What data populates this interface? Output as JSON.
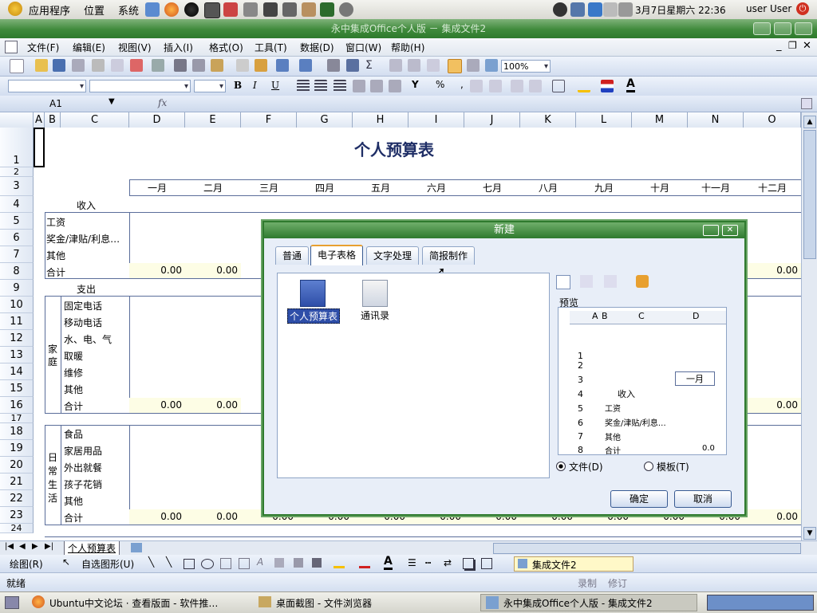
{
  "top_panel": {
    "menus": [
      "应用程序",
      "位置",
      "系统"
    ],
    "clock": "3月7日星期六 22:36",
    "user": "user User"
  },
  "window": {
    "title": "永中集成Office个人版 － 集成文件2"
  },
  "menubar": [
    "文件(F)",
    "编辑(E)",
    "视图(V)",
    "插入(I)",
    "格式(O)",
    "工具(T)",
    "数据(D)",
    "窗口(W)",
    "帮助(H)"
  ],
  "toolbar": {
    "zoom": "100%"
  },
  "formula": {
    "name_box": "A1",
    "fx": "fx"
  },
  "columns": [
    "A",
    "B",
    "C",
    "D",
    "E",
    "F",
    "G",
    "H",
    "I",
    "J",
    "K",
    "L",
    "M",
    "N",
    "O"
  ],
  "rows": [
    "1",
    "2",
    "3",
    "4",
    "5",
    "6",
    "7",
    "8",
    "9",
    "10",
    "11",
    "12",
    "13",
    "14",
    "15",
    "16",
    "17",
    "18",
    "19",
    "20",
    "21",
    "22",
    "23",
    "24"
  ],
  "sheet": {
    "title": "个人预算表",
    "months": [
      "一月",
      "二月",
      "三月",
      "四月",
      "五月",
      "六月",
      "七月",
      "八月",
      "九月",
      "十月",
      "十一月",
      "十二月"
    ],
    "income_label": "收入",
    "income_items": [
      "工资",
      "奖金/津贴/利息…",
      "其他",
      "合计"
    ],
    "expense_label": "支出",
    "family_group": "家庭",
    "family_items": [
      "固定电话",
      "移动电话",
      "水、电、气",
      "取暖",
      "维修",
      "其他",
      "合计"
    ],
    "daily_group": "日常生活",
    "daily_items": [
      "食品",
      "家居用品",
      "外出就餐",
      "孩子花销",
      "其他",
      "合计"
    ],
    "zero": "0.00"
  },
  "dialog": {
    "title": "新建",
    "tabs": [
      "普通",
      "电子表格",
      "文字处理",
      "简报制作"
    ],
    "templates": [
      "个人预算表",
      "通讯录"
    ],
    "preview_label": "预览",
    "preview": {
      "cols": [
        "A",
        "B",
        "C",
        "D"
      ],
      "rows": [
        "1",
        "2",
        "3",
        "4",
        "5",
        "6",
        "7",
        "8"
      ],
      "month": "一月",
      "income": "收入",
      "items": [
        "工资",
        "奖金/津贴/利息…",
        "其他",
        "合计"
      ],
      "sum": "0.0"
    },
    "radio_file": "文件(D)",
    "radio_template": "模板(T)",
    "ok": "确定",
    "cancel": "取消"
  },
  "sheet_tab": "个人预算表",
  "draw_toolbar": {
    "draw": "绘图(R)",
    "autoshape": "自选图形(U)"
  },
  "doc_tab": "集成文件2",
  "status": {
    "ready": "就绪",
    "record": "录制",
    "revise": "修订"
  },
  "taskbar": [
    "Ubuntu中文论坛 · 查看版面 - 软件推…",
    "桌面截图 - 文件浏览器",
    "永中集成Office个人版 - 集成文件2"
  ]
}
